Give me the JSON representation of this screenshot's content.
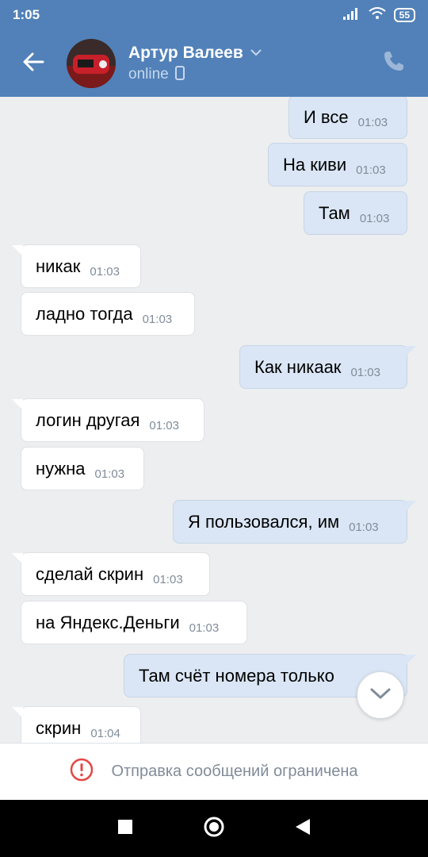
{
  "status_bar": {
    "time": "1:05",
    "battery": "55"
  },
  "header": {
    "contact_name": "Артур Валеев",
    "presence": "online"
  },
  "messages": [
    {
      "dir": "out",
      "text": "И все",
      "time": "01:03"
    },
    {
      "dir": "out",
      "text": "На киви",
      "time": "01:03"
    },
    {
      "dir": "out",
      "text": "Там",
      "time": "01:03"
    },
    {
      "dir": "in",
      "text": "никак",
      "time": "01:03"
    },
    {
      "dir": "in",
      "text": "ладно тогда",
      "time": "01:03"
    },
    {
      "dir": "out",
      "text": "Как никаак",
      "time": "01:03"
    },
    {
      "dir": "in",
      "text": "логин другая",
      "time": "01:03"
    },
    {
      "dir": "in",
      "text": "нужна",
      "time": "01:03"
    },
    {
      "dir": "out",
      "text": "Я пользовался, им",
      "time": "01:03"
    },
    {
      "dir": "in",
      "text": "сделай скрин",
      "time": "01:03"
    },
    {
      "dir": "in",
      "text": "на Яндекс.Деньги",
      "time": "01:03"
    },
    {
      "dir": "out",
      "text": "Там счёт номера только",
      "time": ""
    },
    {
      "dir": "in",
      "text": "скрин",
      "time": "01:04"
    }
  ],
  "composer": {
    "restricted_text": "Отправка сообщений ограничена"
  },
  "colors": {
    "header": "#5181b8",
    "out_bubble": "#dae6f5",
    "in_bubble": "#ffffff",
    "warning": "#e64646"
  }
}
